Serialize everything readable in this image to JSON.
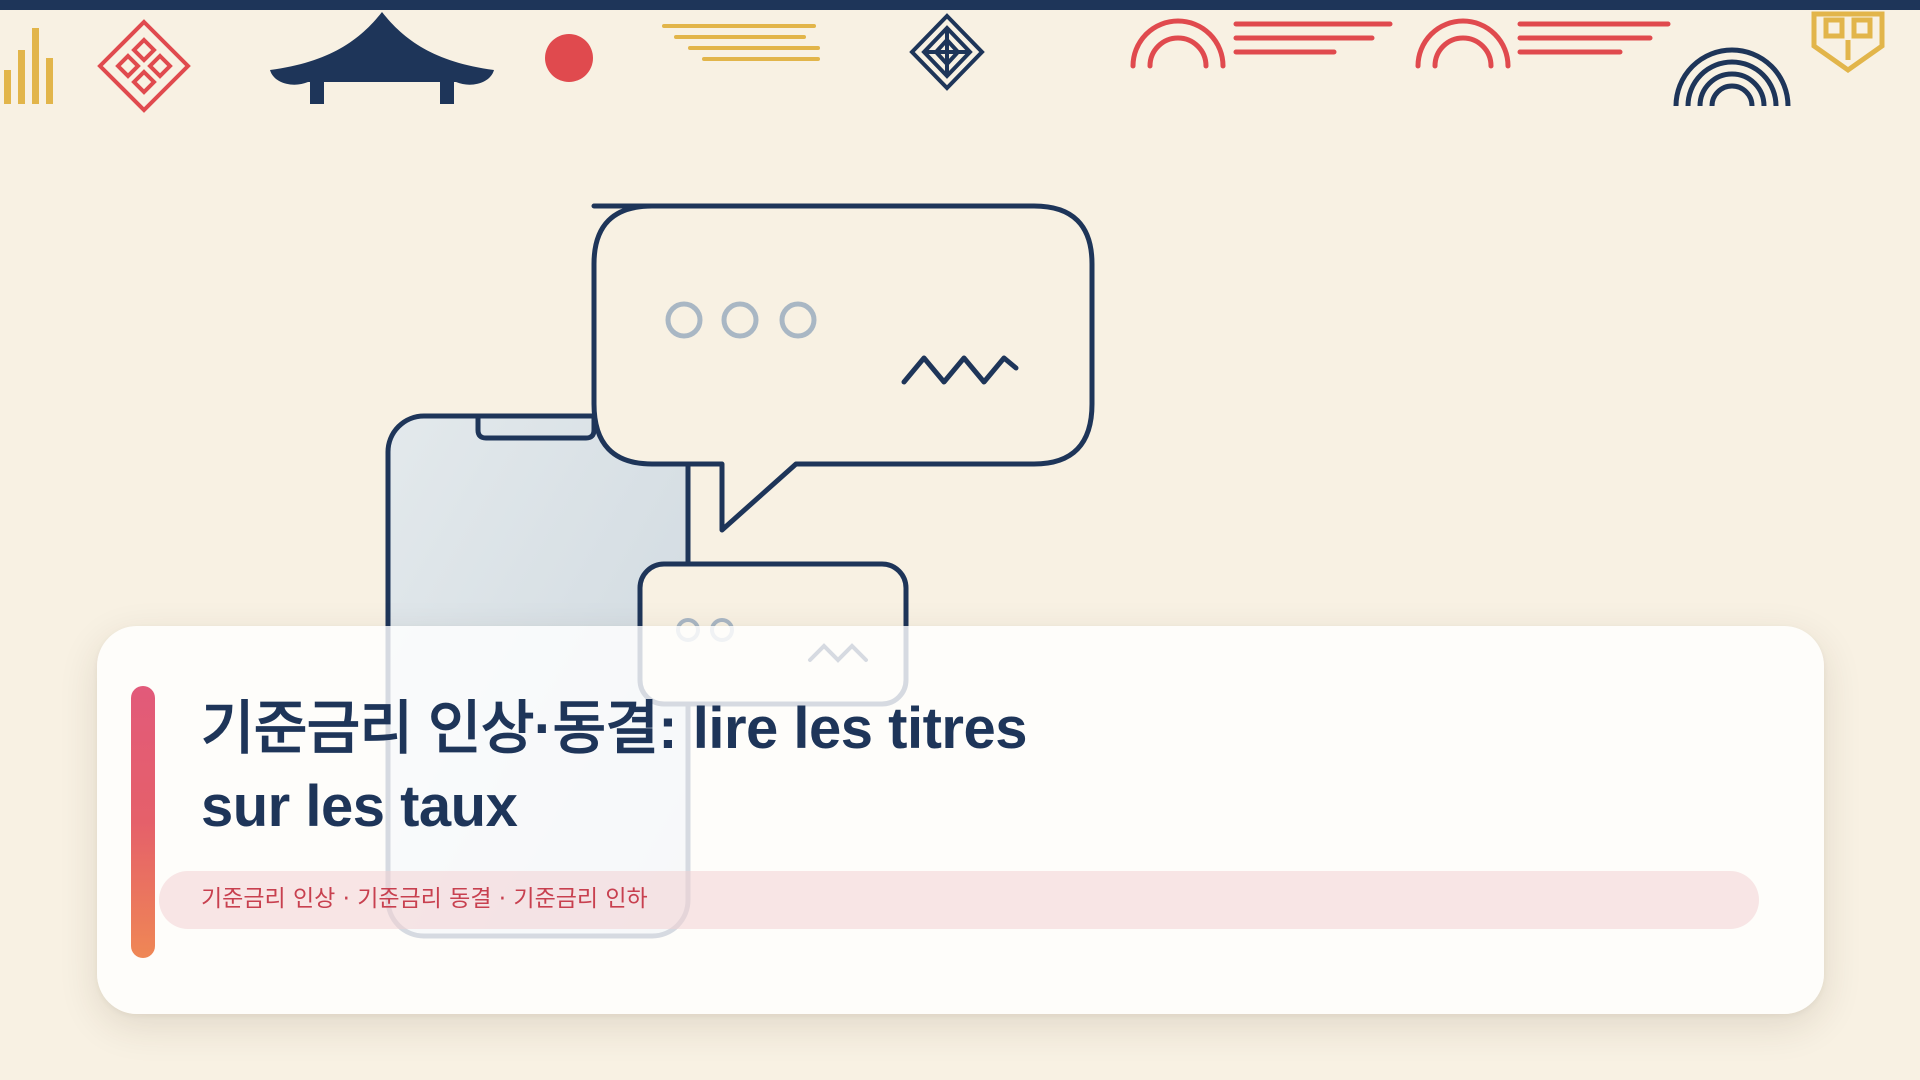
{
  "card": {
    "title_line1": "기준금리 인상·동결: lire les titres",
    "title_line2": "sur les taux",
    "tags": "기준금리 인상 · 기준금리 동결 · 기준금리 인하"
  },
  "illustration": {
    "subject": [
      "smartphone-icon",
      "chat-bubble-icon",
      "typing-dots-icon",
      "squiggle-icon"
    ]
  },
  "decorations": [
    "bars-icon",
    "diamond-pattern-icon",
    "pagoda-roof-icon",
    "red-sun-icon",
    "wavy-lines-icon",
    "lattice-medallion-icon",
    "arch-icon",
    "rainbow-arch-icon",
    "knot-pattern-icon"
  ],
  "colors": {
    "background": "#f8f1e3",
    "navy": "#1e3559",
    "red": "#e04a4e",
    "gold": "#e2b54a",
    "accent_gradient": [
      "#e25a7a",
      "#ef8755"
    ],
    "tag_text": "#c8404f"
  }
}
